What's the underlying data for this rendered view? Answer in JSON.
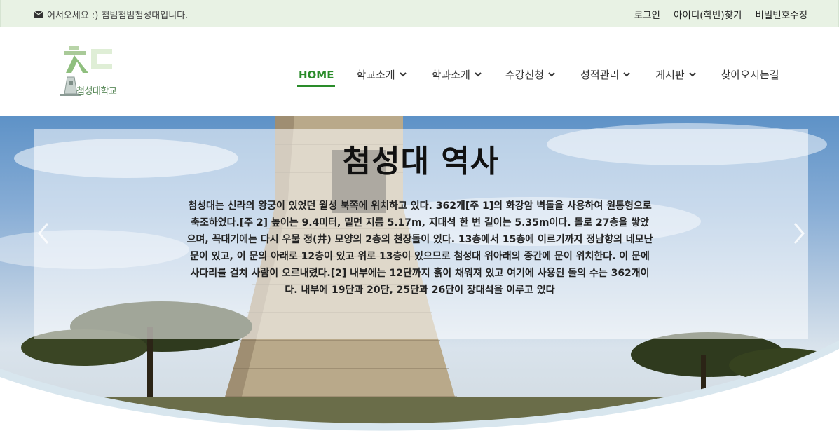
{
  "topbar": {
    "welcome": "어서오세요 :) 첨범첨범첨성대입니다.",
    "mail_icon": "mail-icon",
    "links": [
      "로그인",
      "아이디(학번)찾기",
      "비밀번호수정"
    ]
  },
  "logo": {
    "text": "첨성대학교"
  },
  "nav": {
    "items": [
      {
        "label": "HOME",
        "active": true,
        "dropdown": false
      },
      {
        "label": "학교소개",
        "dropdown": true
      },
      {
        "label": "학과소개",
        "dropdown": true
      },
      {
        "label": "수강신청",
        "dropdown": true
      },
      {
        "label": "성적관리",
        "dropdown": true
      },
      {
        "label": "게시판",
        "dropdown": true
      },
      {
        "label": "찾아오시는길",
        "dropdown": false
      }
    ]
  },
  "hero": {
    "title": "첨성대 역사",
    "body": "첨성대는 신라의 왕궁이 있었던 월성 북쪽에 위치하고 있다. 362개[주 1]의 화강암 벽돌을 사용하여 원통형으로 축조하였다.[주 2] 높이는 9.4미터, 밑면 지름 5.17m, 지대석 한 변 길이는 5.35m이다. 돌로 27층을 쌓았으며, 꼭대기에는 다시 우물 정(井) 모양의 2층의 천장돌이 있다. 13층에서 15층에 이르기까지 정남향의 네모난 문이 있고, 이 문의 아래로 12층이 있고 위로 13층이 있으므로 첨성대 위아래의 중간에 문이 위치한다. 이 문에 사다리를 걸쳐 사람이 오르내렸다.[2] 내부에는 12단까지 흙이 채워져 있고 여기에 사용된 돌의 수는 362개이다. 내부에 19단과 20단, 25단과 26단이 장대석을 이루고 있다",
    "prev_icon": "chevron-left-icon",
    "next_icon": "chevron-right-icon"
  },
  "colors": {
    "accent": "#2a8c2a",
    "topbar_bg": "#e8f2e4"
  }
}
